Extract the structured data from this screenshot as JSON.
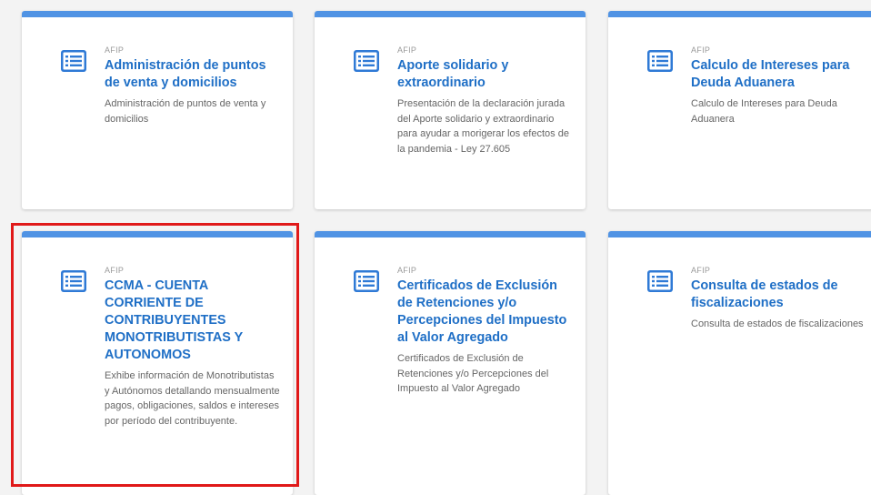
{
  "theme": {
    "accent": "#5093e4",
    "title_color": "#1f6fc6",
    "highlight_color": "#e01919"
  },
  "cards": [
    {
      "provider": "AFIP",
      "icon": "list-document-icon",
      "title": "Administración de puntos de venta y domicilios",
      "description": "Administración de puntos de venta y domicilios"
    },
    {
      "provider": "AFIP",
      "icon": "list-document-icon",
      "title": "Aporte solidario y extraordinario",
      "description": "Presentación de la declaración jurada del Aporte solidario y extraordinario para ayudar a morigerar los efectos de la pandemia - Ley 27.605"
    },
    {
      "provider": "AFIP",
      "icon": "list-document-icon",
      "title": "Calculo de Intereses para Deuda Aduanera",
      "description": "Calculo de Intereses para Deuda Aduanera"
    },
    {
      "provider": "AFIP",
      "icon": "list-document-icon",
      "title": "CCMA - CUENTA CORRIENTE DE CONTRIBUYENTES MONOTRIBUTISTAS Y AUTONOMOS",
      "description": "Exhibe información de Monotributistas y Autónomos detallando mensualmente pagos, obligaciones, saldos e intereses por período del contribuyente.",
      "highlighted": true
    },
    {
      "provider": "AFIP",
      "icon": "list-document-icon",
      "title": "Certificados de Exclusión de Retenciones y/o Percepciones del Impuesto al Valor Agregado",
      "description": "Certificados de Exclusión de Retenciones y/o Percepciones del Impuesto al Valor Agregado"
    },
    {
      "provider": "AFIP",
      "icon": "list-document-icon",
      "title": "Consulta de estados de fiscalizaciones",
      "description": "Consulta de estados de fiscalizaciones"
    }
  ]
}
